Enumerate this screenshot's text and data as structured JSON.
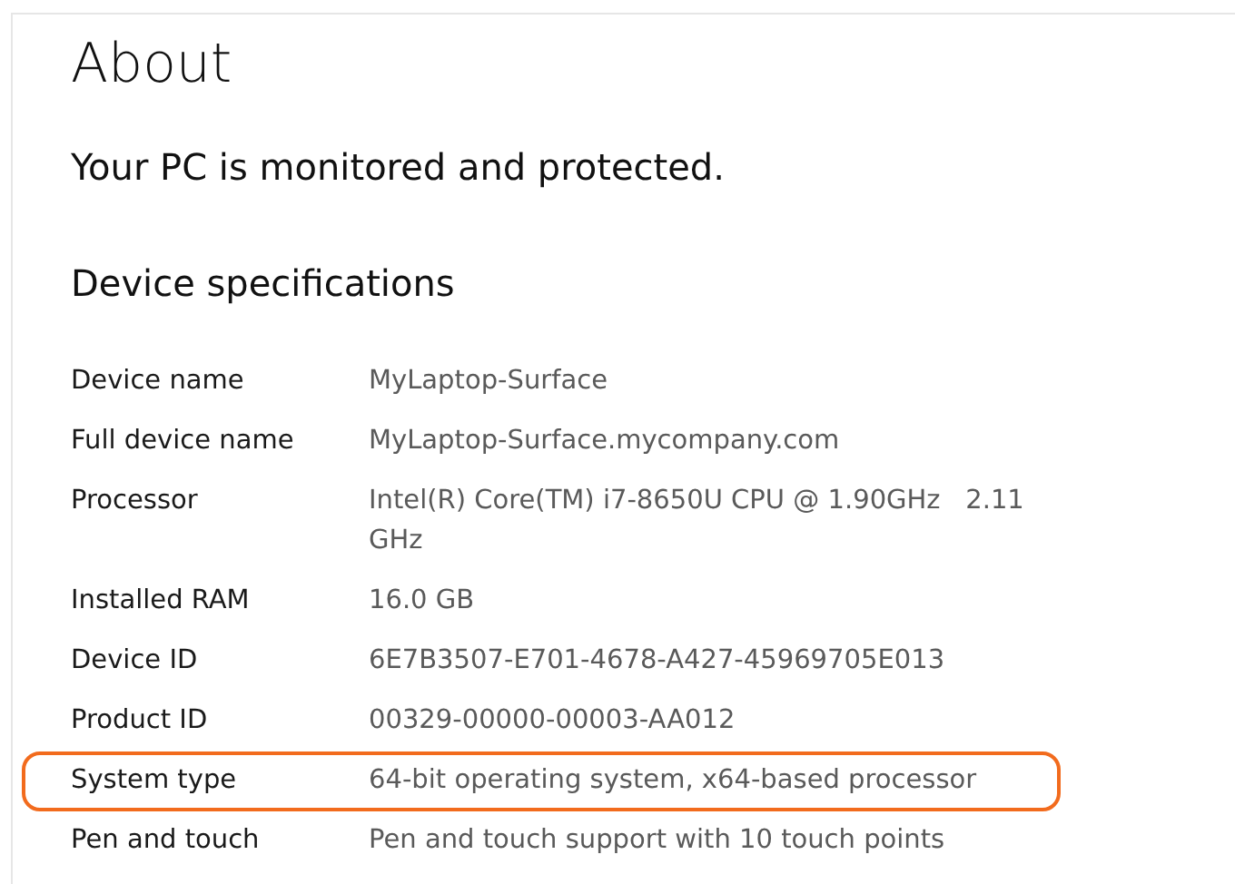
{
  "title": "About",
  "status": "Your PC is monitored and protected.",
  "section_title": "Device specifications",
  "specs": [
    {
      "label": "Device name",
      "value": "MyLaptop-Surface",
      "highlighted": false
    },
    {
      "label": "Full device name",
      "value": "MyLaptop-Surface.mycompany.com",
      "highlighted": false
    },
    {
      "label": "Processor",
      "value": "Intel(R) Core(TM) i7-8650U CPU @ 1.90GHz   2.11 GHz",
      "highlighted": false
    },
    {
      "label": "Installed RAM",
      "value": "16.0 GB",
      "highlighted": false
    },
    {
      "label": "Device ID",
      "value": "6E7B3507-E701-4678-A427-45969705E013",
      "highlighted": false
    },
    {
      "label": "Product ID",
      "value": "00329-00000-00003-AA012",
      "highlighted": false
    },
    {
      "label": "System type",
      "value": "64-bit operating system, x64-based processor",
      "highlighted": true
    },
    {
      "label": "Pen and touch",
      "value": "Pen and touch support with 10 touch points",
      "highlighted": false
    }
  ]
}
